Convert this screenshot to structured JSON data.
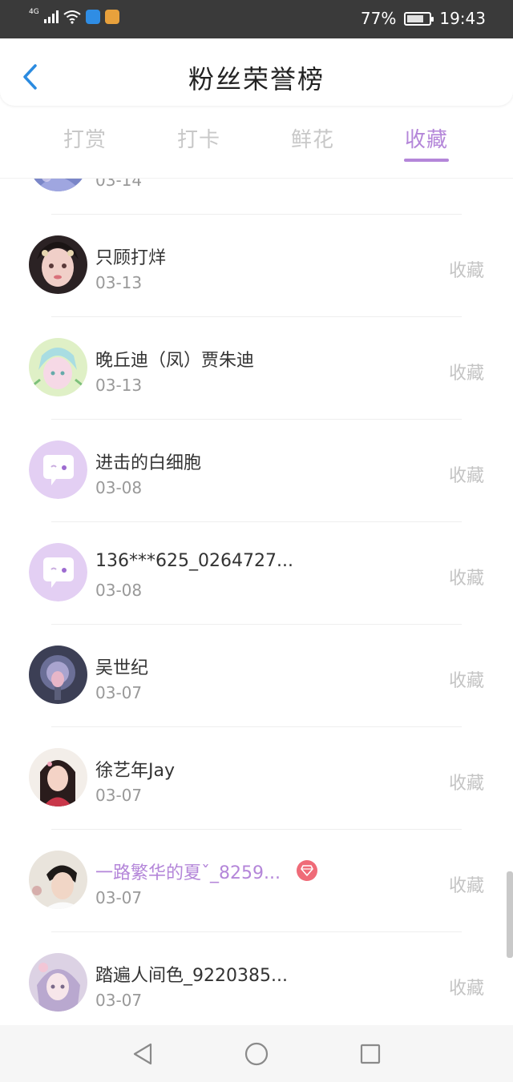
{
  "status_bar": {
    "network_label": "4G",
    "battery_percent": "77%",
    "battery_level": 0.77,
    "time": "19:43",
    "icons": [
      "signal-icon",
      "wifi-icon",
      "shield-app-icon",
      "box-app-icon",
      "battery-icon"
    ]
  },
  "header": {
    "title": "粉丝荣誉榜",
    "back_icon": "chevron-left-icon"
  },
  "tabs": [
    {
      "label": "打赏",
      "active": false
    },
    {
      "label": "打卡",
      "active": false
    },
    {
      "label": "鲜花",
      "active": false
    },
    {
      "label": "收藏",
      "active": true
    }
  ],
  "colors": {
    "accent": "#b486d9",
    "text_primary": "#333333",
    "text_secondary": "#999999",
    "action_text": "#c4c4c4",
    "vip_badge": "#ef6b78",
    "status_bar": "#3a3a3a"
  },
  "list": [
    {
      "name": "",
      "date": "03-14",
      "action": "收藏",
      "avatar": "avatar-photo-1",
      "vip": false
    },
    {
      "name": "只顾打烊",
      "date": "03-13",
      "action": "收藏",
      "avatar": "avatar-photo-2",
      "vip": false
    },
    {
      "name": "晚丘迪（凤）贾朱迪",
      "date": "03-13",
      "action": "收藏",
      "avatar": "avatar-photo-3",
      "vip": false
    },
    {
      "name": "进击的白细胞",
      "date": "03-08",
      "action": "收藏",
      "avatar": "default-chat-avatar-icon",
      "vip": false
    },
    {
      "name": "136***625_0264727...",
      "date": "03-08",
      "action": "收藏",
      "avatar": "default-chat-avatar-icon",
      "vip": false
    },
    {
      "name": "吴世纪",
      "date": "03-07",
      "action": "收藏",
      "avatar": "avatar-photo-4",
      "vip": false
    },
    {
      "name": "徐艺年Jay",
      "date": "03-07",
      "action": "收藏",
      "avatar": "avatar-photo-5",
      "vip": false
    },
    {
      "name": "一路繁华的夏ˇ_8259...",
      "date": "03-07",
      "action": "收藏",
      "avatar": "avatar-photo-6",
      "vip": true,
      "badge_icon": "diamond-icon"
    },
    {
      "name": "踏遍人间色_9220385...",
      "date": "03-07",
      "action": "收藏",
      "avatar": "avatar-photo-7",
      "vip": false
    }
  ],
  "nav_bar": {
    "buttons": [
      "back-triangle-icon",
      "home-circle-icon",
      "recents-square-icon"
    ]
  }
}
